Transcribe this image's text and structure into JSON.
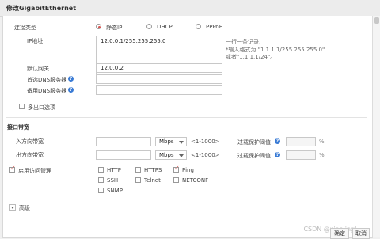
{
  "title": "修改GigabitEthernet",
  "conn": {
    "label": "连接类型",
    "options": [
      "静态IP",
      "DHCP",
      "PPPoE"
    ],
    "selected": 0
  },
  "ip": {
    "label": "IP地址",
    "value": "12.0.0.1/255.255.255.0",
    "hint1": "一行一条记录,",
    "hint2": "*输入格式为 \"1.1.1.1/255.255.255.0\"",
    "hint3": "或者\"1.1.1.1/24\"。"
  },
  "gateway": {
    "label": "默认网关",
    "value": "12.0.0.2"
  },
  "dns1": {
    "label": "首选DNS服务器",
    "value": ""
  },
  "dns2": {
    "label": "备用DNS服务器",
    "value": ""
  },
  "multi_exit": {
    "label": "多出口选项",
    "checked": false
  },
  "bandwidth": {
    "section_title": "接口带宽",
    "in_label": "入方向带宽",
    "out_label": "出方向带宽",
    "unit": "Mbps",
    "range": "<1-1000>",
    "threshold_label": "过载保护阈值",
    "percent": "%"
  },
  "access": {
    "label": "启用访问管理",
    "checked": true,
    "items": [
      {
        "label": "HTTP",
        "checked": false
      },
      {
        "label": "HTTPS",
        "checked": false
      },
      {
        "label": "Ping",
        "checked": true
      },
      {
        "label": "SSH",
        "checked": false
      },
      {
        "label": "Telnet",
        "checked": false
      },
      {
        "label": "NETCONF",
        "checked": false
      },
      {
        "label": "SNMP",
        "checked": false
      }
    ]
  },
  "advanced": {
    "label": "高级"
  },
  "buttons": {
    "ok": "确定",
    "cancel": "取消"
  },
  "watermark": "CSDN @xiaojingl..."
}
